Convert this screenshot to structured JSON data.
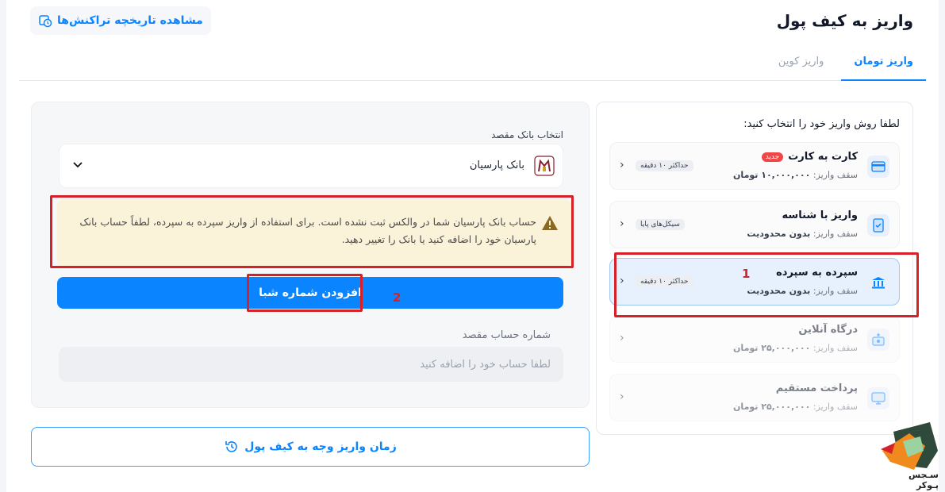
{
  "header": {
    "title": "واریز به کیف پول",
    "history_link": "مشاهده تاریخچه تراکنش‌ها"
  },
  "tabs": [
    {
      "label": "واریز تومان",
      "active": true
    },
    {
      "label": "واریز کوین",
      "active": false
    }
  ],
  "methods": {
    "title": "لطفا روش واریز خود را انتخاب کنید:",
    "items": [
      {
        "name": "کارت به کارت",
        "badge": "جدید",
        "limit_prefix": "سقف واریز:",
        "limit_value": "۱۰,۰۰۰,۰۰۰ تومان",
        "tag": "حداکثر ۱۰ دقیقه",
        "state": "normal"
      },
      {
        "name": "واریز با شناسه",
        "badge": "",
        "limit_prefix": "سقف واریز:",
        "limit_value": "بدون محدودیت",
        "tag": "سیکل‌های پایا",
        "state": "normal"
      },
      {
        "name": "سپرده به سپرده",
        "badge": "",
        "limit_prefix": "سقف واریز:",
        "limit_value": "بدون محدودیت",
        "tag": "حداکثر ۱۰ دقیقه",
        "state": "selected"
      },
      {
        "name": "درگاه آنلاین",
        "badge": "",
        "limit_prefix": "سقف واریز:",
        "limit_value": "۲۵,۰۰۰,۰۰۰ تومان",
        "tag": "",
        "state": "disabled"
      },
      {
        "name": "پرداخت مستقیم",
        "badge": "",
        "limit_prefix": "سقف واریز:",
        "limit_value": "۲۵,۰۰۰,۰۰۰ تومان",
        "tag": "",
        "state": "disabled"
      }
    ]
  },
  "form": {
    "bank_label": "انتخاب بانک مقصد",
    "bank_selected": "بانک پارسیان",
    "warning_text": "حساب بانک پارسیان شما در والکس ثبت نشده است. برای استفاده از واریز سپرده به سپرده، لطفاً حساب بانک پارسیان خود را اضافه کنید یا بانک را تغییر دهید.",
    "add_button": "افزودن شماره شبا",
    "account_label": "شماره حساب مقصد",
    "account_placeholder": "لطفا حساب خود را اضافه کنید",
    "account_value": ""
  },
  "time_button": "زمان واریز وجه به کیف پول",
  "annotations": {
    "marker_1": "1",
    "marker_2": "2"
  },
  "watermark": "سـجس پـوکر",
  "colors": {
    "accent": "#0a84ff",
    "warning_bg": "#fbf2da",
    "annotation_red": "#d62128",
    "badge_red": "#f04646"
  },
  "icons": {
    "history": "history-clock-icon",
    "card": "card-icon",
    "id_deposit": "receipt-check-icon",
    "bank": "bank-building-icon",
    "online": "online-gateway-icon",
    "direct": "screen-pay-icon",
    "chevron": "chevron-left-icon",
    "select_chevron": "chevron-down-icon",
    "warning": "warning-triangle-icon",
    "time": "clock-refresh-icon"
  }
}
